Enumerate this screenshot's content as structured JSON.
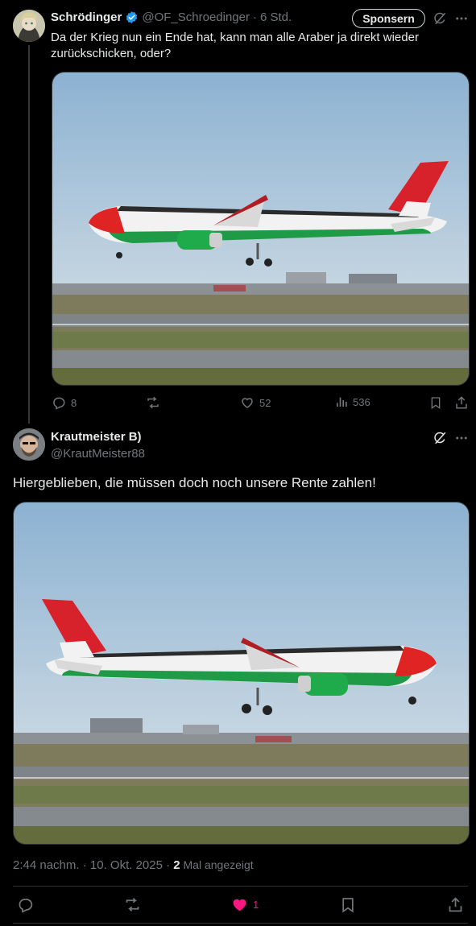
{
  "tweet1": {
    "display_name": "Schrödinger",
    "handle": "@OF_Schroedinger",
    "separator": "·",
    "time": "6 Std.",
    "sponsor_label": "Sponsern",
    "text": "Da der Krieg nun ein Ende hat, kann man alle Araber ja direkt wieder zurückschicken, oder?",
    "actions": {
      "replies": "8",
      "likes": "52",
      "views": "536"
    }
  },
  "tweet2": {
    "display_name": "Krautmeister B)",
    "handle": "@KrautMeister88",
    "text": "Hiergeblieben, die müssen doch noch unsere Rente zahlen!",
    "meta": {
      "time": "2:44 nachm. · 10. Okt. 2025 · ",
      "views_count": "2",
      "views_label": " Mal angezeigt"
    },
    "actions": {
      "likes": "1"
    }
  },
  "colors": {
    "verified": "#1d9bf0",
    "like_active": "#f91880",
    "muted": "#71767b"
  },
  "icons": [
    "verified-badge-icon",
    "grok-icon",
    "more-icon",
    "reply-icon",
    "retweet-icon",
    "like-icon",
    "views-icon",
    "bookmark-icon",
    "share-icon"
  ]
}
